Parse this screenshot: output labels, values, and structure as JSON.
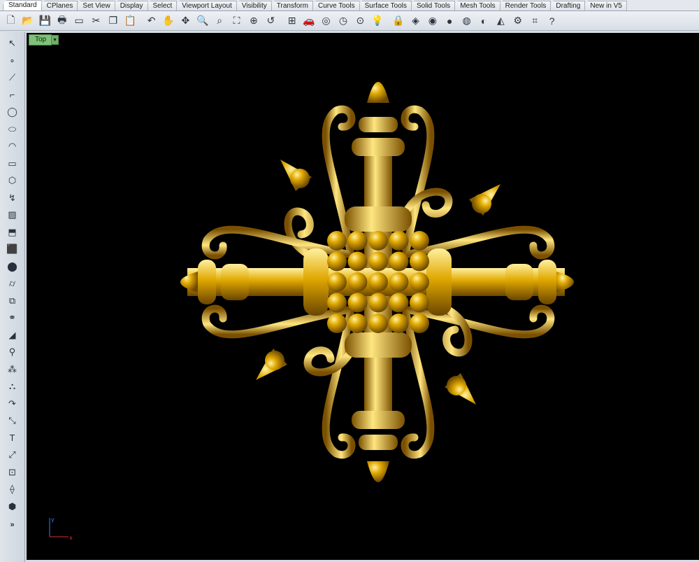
{
  "tabs": [
    "Standard",
    "CPlanes",
    "Set View",
    "Display",
    "Select",
    "Viewport Layout",
    "Visibility",
    "Transform",
    "Curve Tools",
    "Surface Tools",
    "Solid Tools",
    "Mesh Tools",
    "Render Tools",
    "Drafting",
    "New in V5"
  ],
  "active_tab": "Standard",
  "toolbar": {
    "icons": [
      {
        "name": "new-icon",
        "glyph": "🗋"
      },
      {
        "name": "open-icon",
        "glyph": "📂"
      },
      {
        "name": "save-icon",
        "glyph": "💾"
      },
      {
        "name": "print-icon",
        "glyph": "🖶"
      },
      {
        "name": "properties-icon",
        "glyph": "▭"
      },
      {
        "name": "cut-icon",
        "glyph": "✂"
      },
      {
        "name": "copy-icon",
        "glyph": "❐"
      },
      {
        "name": "paste-icon",
        "glyph": "📋"
      },
      {
        "name": "undo-icon",
        "glyph": "↶"
      },
      {
        "name": "pan-icon",
        "glyph": "✋"
      },
      {
        "name": "rotate-view-icon",
        "glyph": "✥"
      },
      {
        "name": "zoom-icon",
        "glyph": "🔍"
      },
      {
        "name": "zoom-window-icon",
        "glyph": "⌕"
      },
      {
        "name": "zoom-extents-icon",
        "glyph": "⛶"
      },
      {
        "name": "zoom-selected-icon",
        "glyph": "⊕"
      },
      {
        "name": "undo-view-icon",
        "glyph": "↺"
      },
      {
        "name": "four-viewports-icon",
        "glyph": "⊞"
      },
      {
        "name": "car-icon",
        "glyph": "🚗"
      },
      {
        "name": "camera-icon",
        "glyph": "◎"
      },
      {
        "name": "dial-icon",
        "glyph": "◷"
      },
      {
        "name": "target-icon",
        "glyph": "⊙"
      },
      {
        "name": "light-icon",
        "glyph": "💡"
      },
      {
        "name": "lock-icon",
        "glyph": "🔒"
      },
      {
        "name": "layer-icon",
        "glyph": "◈"
      },
      {
        "name": "color-wheel-icon",
        "glyph": "◉"
      },
      {
        "name": "sphere-icon",
        "glyph": "●"
      },
      {
        "name": "shaded-sphere-icon",
        "glyph": "◍"
      },
      {
        "name": "render-icon",
        "glyph": "◐"
      },
      {
        "name": "spotlight-icon",
        "glyph": "◭"
      },
      {
        "name": "options-gear-icon",
        "glyph": "⚙"
      },
      {
        "name": "osnap-icon",
        "glyph": "⌗"
      },
      {
        "name": "help-icon",
        "glyph": "?"
      }
    ]
  },
  "left_toolbar": {
    "icons": [
      {
        "name": "select-arrow-icon",
        "glyph": "↖"
      },
      {
        "name": "point-icon",
        "glyph": "∘"
      },
      {
        "name": "polyline-icon",
        "glyph": "⟋"
      },
      {
        "name": "curve-icon",
        "glyph": "⌐"
      },
      {
        "name": "circle-icon",
        "glyph": "◯"
      },
      {
        "name": "ellipse-icon",
        "glyph": "⬭"
      },
      {
        "name": "arc-icon",
        "glyph": "◠"
      },
      {
        "name": "rectangle-icon",
        "glyph": "▭"
      },
      {
        "name": "polygon-icon",
        "glyph": "⬡"
      },
      {
        "name": "fillet-icon",
        "glyph": "↯"
      },
      {
        "name": "surface-icon",
        "glyph": "▨"
      },
      {
        "name": "extrude-icon",
        "glyph": "⬒"
      },
      {
        "name": "box-icon",
        "glyph": "⬛"
      },
      {
        "name": "sphere-solid-icon",
        "glyph": "⬤"
      },
      {
        "name": "cylinder-icon",
        "glyph": "⌭"
      },
      {
        "name": "mesh-icon",
        "glyph": "⧉"
      },
      {
        "name": "boolean-icon",
        "glyph": "⚭"
      },
      {
        "name": "dimension-icon",
        "glyph": "◢"
      },
      {
        "name": "group-icon",
        "glyph": "⚲"
      },
      {
        "name": "point-cloud-icon",
        "glyph": "⁂"
      },
      {
        "name": "array-icon",
        "glyph": "⛬"
      },
      {
        "name": "rotate-icon",
        "glyph": "↷"
      },
      {
        "name": "trim-icon",
        "glyph": "⤡"
      },
      {
        "name": "text-icon",
        "glyph": "T"
      },
      {
        "name": "transform-icon",
        "glyph": "⤢"
      },
      {
        "name": "block-icon",
        "glyph": "⊡"
      },
      {
        "name": "analyze-icon",
        "glyph": "⟠"
      },
      {
        "name": "render-cube-icon",
        "glyph": "⬢"
      }
    ],
    "more_label": "»"
  },
  "viewport": {
    "title": "Top",
    "background": "#000000",
    "ornament_color": "#e0a800",
    "axis_y_label": "y",
    "axis_x_label": "x",
    "axis_y_color": "#3a7bff",
    "axis_x_color": "#e03030"
  }
}
